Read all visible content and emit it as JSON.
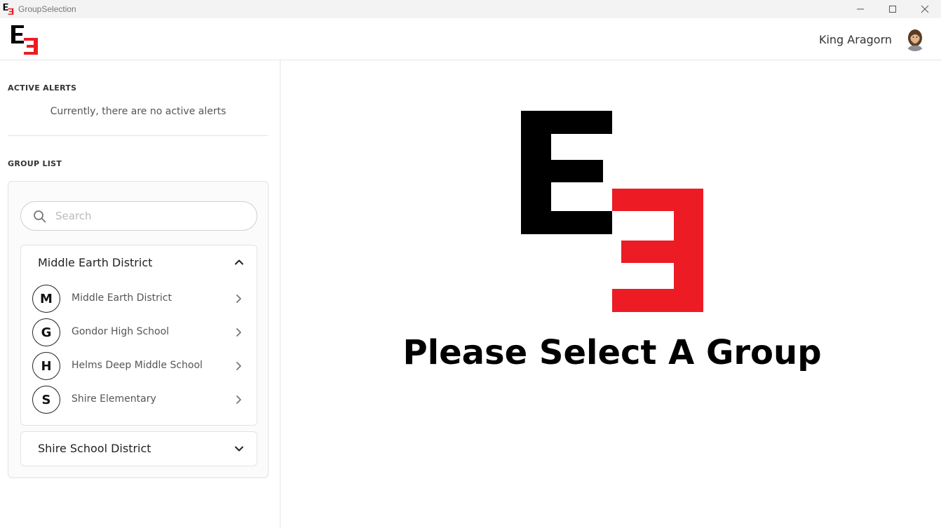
{
  "window": {
    "title": "GroupSelection"
  },
  "header": {
    "user_name": "King Aragorn",
    "avatar_icon": "user-avatar"
  },
  "sidebar": {
    "alerts": {
      "title": "ACTIVE ALERTS",
      "message": "Currently, there are no active alerts"
    },
    "group_list": {
      "title": "GROUP LIST",
      "search_placeholder": "Search",
      "search_value": "",
      "districts": [
        {
          "name": "Middle Earth District",
          "expanded": true,
          "schools": [
            {
              "initial": "M",
              "name": "Middle Earth District"
            },
            {
              "initial": "G",
              "name": "Gondor High School"
            },
            {
              "initial": "H",
              "name": "Helms Deep Middle School"
            },
            {
              "initial": "S",
              "name": "Shire Elementary"
            }
          ]
        },
        {
          "name": "Shire School District",
          "expanded": false,
          "schools": []
        }
      ]
    }
  },
  "main": {
    "message": "Please Select A Group"
  },
  "colors": {
    "brand_black": "#000000",
    "brand_red": "#ed1c24"
  }
}
